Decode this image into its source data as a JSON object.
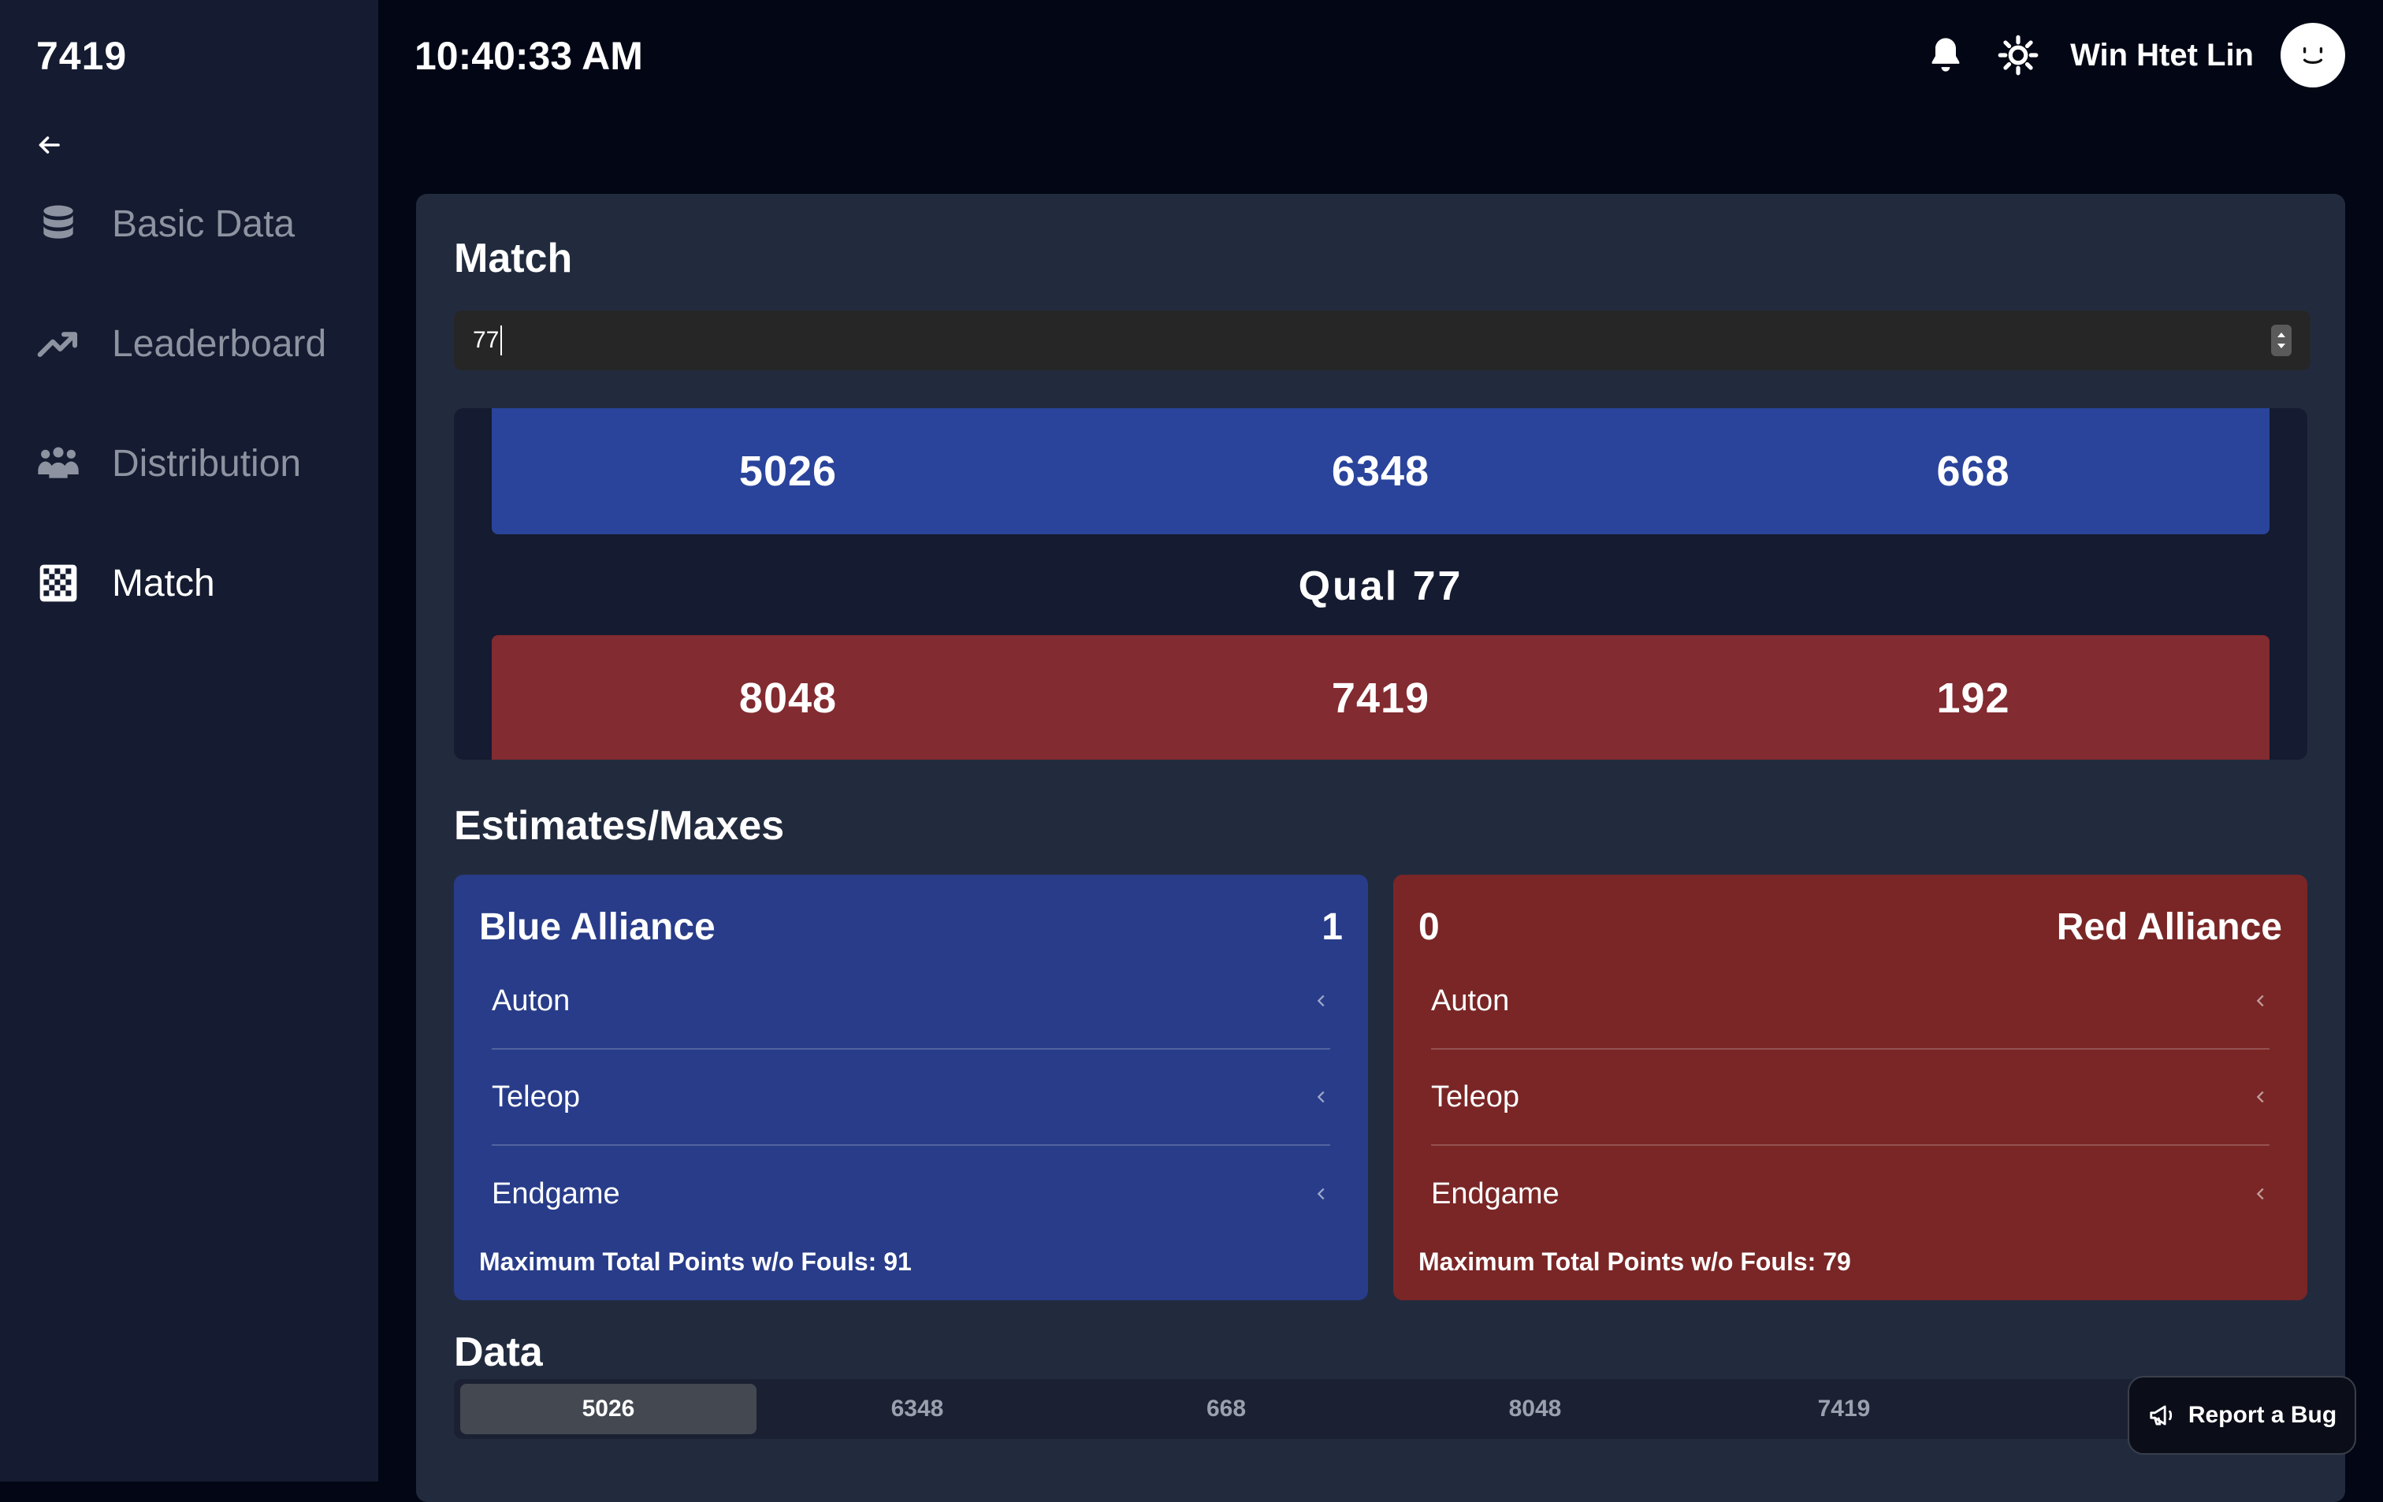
{
  "sidebar": {
    "brand": "7419",
    "items": [
      {
        "label": "Basic Data",
        "icon": "database-icon",
        "active": false
      },
      {
        "label": "Leaderboard",
        "icon": "trending-up-icon",
        "active": false
      },
      {
        "label": "Distribution",
        "icon": "people-group-icon",
        "active": false
      },
      {
        "label": "Match",
        "icon": "checkered-flag-icon",
        "active": true
      }
    ]
  },
  "topbar": {
    "time": "10:40:33 AM",
    "user_name": "Win Htet Lin"
  },
  "match": {
    "title": "Match",
    "input_value": "77",
    "qual_label": "Qual 77",
    "blue_teams": [
      "5026",
      "6348",
      "668"
    ],
    "red_teams": [
      "8048",
      "7419",
      "192"
    ]
  },
  "estimates": {
    "title": "Estimates/Maxes",
    "blue": {
      "name": "Blue Alliance",
      "score": "1",
      "sections": [
        "Auton",
        "Teleop",
        "Endgame"
      ],
      "max_line": "Maximum Total Points w/o Fouls: 91"
    },
    "red": {
      "name": "Red Alliance",
      "score": "0",
      "sections": [
        "Auton",
        "Teleop",
        "Endgame"
      ],
      "max_line": "Maximum Total Points w/o Fouls: 79"
    }
  },
  "data_section": {
    "title": "Data",
    "tabs": [
      "5026",
      "6348",
      "668",
      "8048",
      "7419"
    ],
    "active_tab": "5026"
  },
  "report_bug": "Report a Bug",
  "colors": {
    "blue_alliance": "#2a449b",
    "red_alliance": "#822b30",
    "panel": "#222b3e",
    "sidebar": "#151b30"
  }
}
